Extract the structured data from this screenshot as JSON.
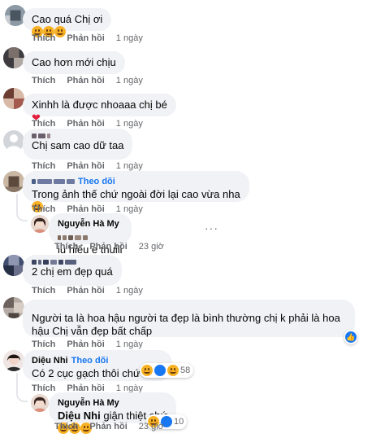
{
  "labels": {
    "like": "Thích",
    "reply": "Phản hồi",
    "follow": "Theo dõi"
  },
  "comments": [
    {
      "text": "Cao quá Chị ơi",
      "time": "1 ngày"
    },
    {
      "text": "Cao hơn mới chịu",
      "time": "1 ngày"
    },
    {
      "text": "Xinhh là được nhoaaa chị bé",
      "time": "1 ngày"
    },
    {
      "text": "Chị sam cao dữ taa",
      "time": "1 ngày"
    },
    {
      "text": "Trong ảnh thế chứ ngoài đời lại cao vừa nha",
      "time": "1 ngày",
      "reply": {
        "author": "Nguyễn Hà My",
        "text": "iu hiểu e thuiii",
        "time": "23 giờ"
      }
    },
    {
      "text": "2 chị em đẹp quá",
      "time": "1 ngày"
    },
    {
      "text": "Người ta là hoa hậu người ta đẹp là bình thường chị k phải là hoa hậu Chị vẫn đẹp bất chấp",
      "time": "1 ngày"
    },
    {
      "author": "Diệu Nhi",
      "text": "Có 2 cục gạch thôi chứ nhiu",
      "time": "1 ngày",
      "reactions": "58",
      "reply": {
        "author": "Nguyễn Hà My",
        "mention": "Diệu Nhi",
        "text": " giận thiệt chứ",
        "time": "23 giờ",
        "reactions": "10"
      }
    }
  ],
  "colors": {
    "bubble": "#f0f2f5",
    "link": "#1877f2",
    "muted": "#65676b",
    "emoji": "#f7b125"
  },
  "icons": [
    "more-options-icon",
    "laugh-emoji-icon",
    "heart-icon",
    "like-reaction-icon"
  ]
}
